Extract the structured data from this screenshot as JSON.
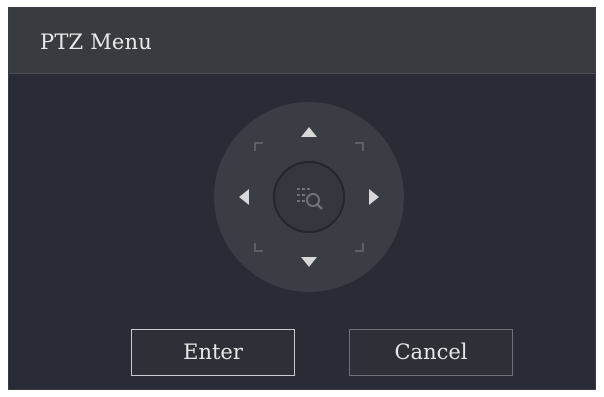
{
  "dialog": {
    "title": "PTZ Menu"
  },
  "ptz": {
    "up_icon": "arrow-up-icon",
    "down_icon": "arrow-down-icon",
    "left_icon": "arrow-left-icon",
    "right_icon": "arrow-right-icon",
    "center_icon": "menu-search-icon",
    "diagonal_icons": [
      "arrow-up-left-icon",
      "arrow-up-right-icon",
      "arrow-down-left-icon",
      "arrow-down-right-icon"
    ]
  },
  "buttons": {
    "enter_label": "Enter",
    "cancel_label": "Cancel"
  },
  "colors": {
    "background": "#292c35",
    "titlebar": "#383b40",
    "ring": "#3a3d44",
    "arrow": "#d8d8d8",
    "diagonal": "#5c6068"
  }
}
